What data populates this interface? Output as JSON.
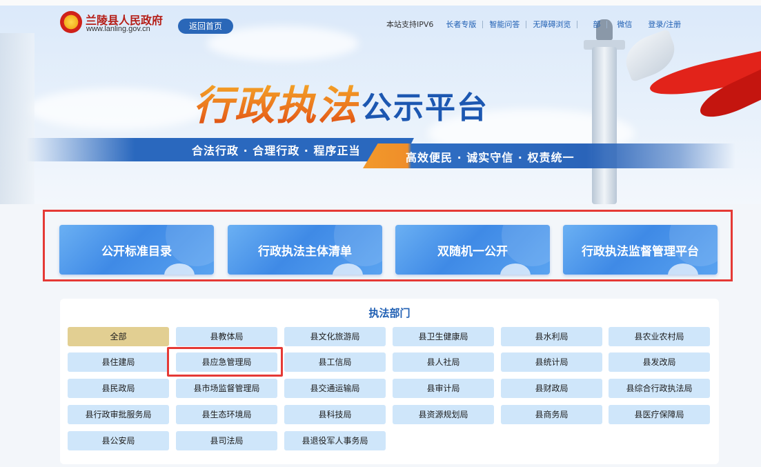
{
  "header": {
    "site_name": "兰陵县人民政府",
    "site_url": "www.lanling.gov.cn",
    "home_button": "返回首页",
    "top_links": {
      "ipv6": "本站支持IPV6",
      "elder": "长者专版",
      "qa": "智能问答",
      "accessible": "无障碍浏览",
      "mail": "部",
      "wechat": "微信",
      "login": "登录/注册"
    }
  },
  "banner": {
    "title_brush": "行政执法",
    "title_plain": "公示平台",
    "slogan_left": "合法行政 · 合理行政 · 程序正当",
    "slogan_right": "高效便民 · 诚实守信 · 权责统一"
  },
  "quick_tiles": [
    {
      "label": "公开标准目录"
    },
    {
      "label": "行政执法主体清单"
    },
    {
      "label": "双随机一公开"
    },
    {
      "label": "行政执法监督管理平台"
    }
  ],
  "departments": {
    "title": "执法部门",
    "items": [
      {
        "label": "全部",
        "active": true
      },
      {
        "label": "县教体局"
      },
      {
        "label": "县文化旅游局"
      },
      {
        "label": "县卫生健康局"
      },
      {
        "label": "县水利局"
      },
      {
        "label": "县农业农村局"
      },
      {
        "label": "县住建局"
      },
      {
        "label": "县应急管理局"
      },
      {
        "label": "县工信局"
      },
      {
        "label": "县人社局"
      },
      {
        "label": "县统计局"
      },
      {
        "label": "县发改局"
      },
      {
        "label": "县民政局"
      },
      {
        "label": "县市场监督管理局"
      },
      {
        "label": "县交通运输局"
      },
      {
        "label": "县审计局"
      },
      {
        "label": "县财政局"
      },
      {
        "label": "县综合行政执法局"
      },
      {
        "label": "县行政审批服务局"
      },
      {
        "label": "县生态环境局"
      },
      {
        "label": "县科技局"
      },
      {
        "label": "县资源规划局"
      },
      {
        "label": "县商务局"
      },
      {
        "label": "县医疗保障局"
      },
      {
        "label": "县公安局"
      },
      {
        "label": "县司法局"
      },
      {
        "label": "县退役军人事务局"
      }
    ]
  },
  "colors": {
    "primary_blue": "#2a67b8",
    "gov_red": "#b51d16",
    "highlight_red": "#e53935",
    "dept_button": "#cfe6fa",
    "dept_active": "#e2cf92",
    "slogan_orange": "#f2992b"
  },
  "icons": {
    "emblem": "national-emblem-icon"
  }
}
